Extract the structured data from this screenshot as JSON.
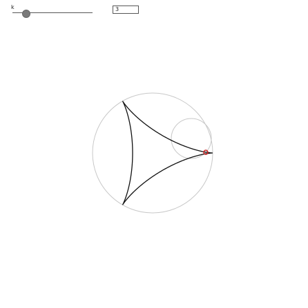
{
  "slider": {
    "label": "k",
    "value": 3
  },
  "input": {
    "value": "3"
  },
  "colors": {
    "outer_circle": "#c8c8c8",
    "rolling_circle": "#c8c8c8",
    "curve": "#000000",
    "tracer_point": "#cc2222"
  }
}
